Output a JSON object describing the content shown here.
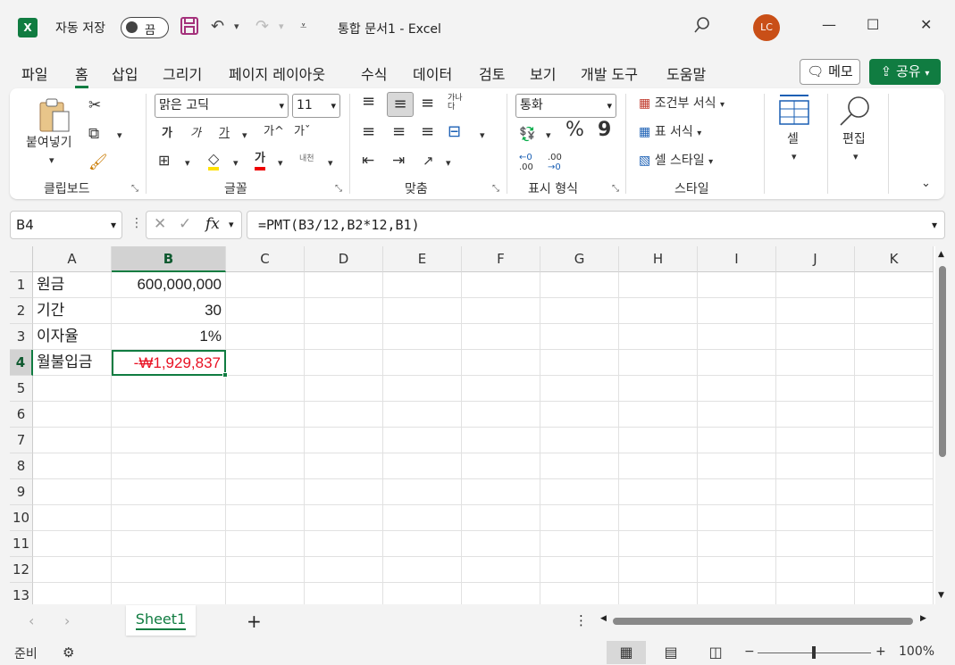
{
  "title_bar": {
    "app_icon": "X",
    "autosave_label": "자동 저장",
    "autosave_state": "끔",
    "document_title": "통합 문서1  -  Excel",
    "user_initials": "LC"
  },
  "menu": {
    "items": [
      "파일",
      "홈",
      "삽입",
      "그리기",
      "페이지 레이아웃",
      "수식",
      "데이터",
      "검토",
      "보기",
      "개발 도구",
      "도움말"
    ],
    "active": "홈",
    "memo_label": "메모",
    "share_label": "공유"
  },
  "ribbon": {
    "clipboard": {
      "paste_label": "붙여넣기",
      "group_label": "클립보드"
    },
    "font": {
      "font_name": "맑은 고딕",
      "font_size": "11",
      "bold": "가",
      "italic": "가",
      "underline": "가",
      "grow": "가^",
      "shrink": "가ˇ",
      "color_letter": "가",
      "phonetic": "내천",
      "group_label": "글꼴"
    },
    "alignment": {
      "wrap": "가나 다",
      "group_label": "맞춤"
    },
    "number": {
      "format": "통화",
      "percent": "%",
      "comma": "9",
      "inc_decimal": ".00",
      "dec_decimal": ".00",
      "group_label": "표시 형식"
    },
    "styles": {
      "conditional": "조건부 서식",
      "table": "표 서식",
      "cell_style": "셀 스타일",
      "group_label": "스타일"
    },
    "cells": {
      "label": "셀"
    },
    "editing": {
      "label": "편집"
    }
  },
  "formula_bar": {
    "name_box": "B4",
    "fx": "fx",
    "formula": "=PMT(B3/12,B2*12,B1)"
  },
  "grid": {
    "columns": [
      "A",
      "B",
      "C",
      "D",
      "E",
      "F",
      "G",
      "H",
      "I",
      "J",
      "K"
    ],
    "selected_column": "B",
    "rows": [
      "1",
      "2",
      "3",
      "4",
      "5",
      "6",
      "7",
      "8",
      "9",
      "10",
      "11",
      "12",
      "13"
    ],
    "selected_row": "4",
    "cells": {
      "A1": "원금",
      "B1": "600,000,000",
      "A2": "기간",
      "B2": "30",
      "A3": "이자율",
      "B3": "1%",
      "A4": "월불입금",
      "B4": "-₩1,929,837"
    },
    "negative_color": "#e81123",
    "accent_color": "#107c41"
  },
  "sheets": {
    "tabs": [
      "Sheet1"
    ],
    "active": "Sheet1",
    "add_label": "+"
  },
  "status_bar": {
    "mode": "준비",
    "zoom_minus": "−",
    "zoom_plus": "+",
    "zoom": "100%"
  }
}
